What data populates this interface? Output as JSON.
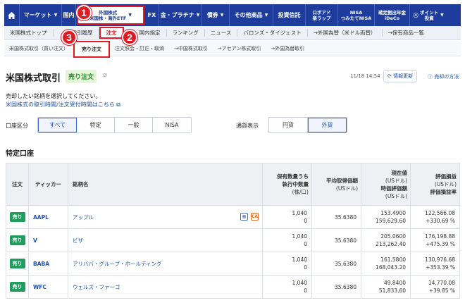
{
  "topnav": {
    "items": [
      {
        "label": "マーケット"
      },
      {
        "label": "国内"
      },
      {
        "label": "外国株式",
        "sub": "米国株・海外ETF"
      },
      {
        "label": "FX"
      },
      {
        "label": "金・プラチナ"
      },
      {
        "label": "債券"
      },
      {
        "label": "その他商品"
      },
      {
        "label": "投資信託"
      },
      {
        "label": "ロボアド",
        "sub": "楽ラップ"
      },
      {
        "label": "NISA",
        "sub": "つみたてNISA"
      },
      {
        "label": "確定拠出年金",
        "sub": "iDeCo"
      },
      {
        "label": "ポイント",
        "sub": "投資"
      }
    ]
  },
  "subnav1": {
    "items": [
      "米国株式トップ",
      "取引履歴",
      "注文",
      "国内指定",
      "ランキング",
      "ニュース",
      "バロンズ・ダイジェスト",
      "→外国為替（米ドル両替）",
      "→保有商品一覧"
    ]
  },
  "subnav2": {
    "items": [
      "米国株式取引（買い注文）",
      "売り注文",
      "注文照会・訂正・取消",
      "→中国株式取引",
      "→アセアン株式取引",
      "→外国為替取引"
    ]
  },
  "badges": [
    "1",
    "2",
    "3"
  ],
  "page": {
    "title": "米国株式取引",
    "tag": "売り注文",
    "timestamp": "11/18 14:54",
    "refresh_label": "情報更新",
    "howto_label": "売却の方法",
    "description": "売却したい銘柄を選択してください。",
    "link": "米国株式の取引時間/注文受付時間はこちら"
  },
  "filters": {
    "account_label": "口座区分",
    "account_options": [
      "すべて",
      "特定",
      "一般",
      "NISA"
    ],
    "account_selected": "すべて",
    "currency_label": "通貨表示",
    "currency_options": [
      "円貨",
      "外貨"
    ],
    "currency_selected": "外貨"
  },
  "section_title": "特定口座",
  "table": {
    "headers": {
      "order": "注文",
      "ticker": "ティッカー",
      "name": "銘柄名",
      "qty1": "保有数量うち",
      "qty2": "執行中数量",
      "qty3": "(株/口)",
      "avg1": "平均取得価額",
      "avg2": "(USドル)",
      "cur1": "現在値",
      "cur2": "(USドル)",
      "cur3": "時価評価額",
      "cur4": "(USドル)",
      "pl1": "評価損益",
      "pl2": "(USドル)",
      "pl3": "評価損益率"
    },
    "sell_label": "売り",
    "rows": [
      {
        "ticker": "AAPL",
        "name": "アップル",
        "qty": "1,040",
        "qty_exec": "0",
        "avg": "35.6380",
        "price": "153.4900",
        "value": "159,629.60",
        "pl": "122,566.08",
        "plr": "+330.69 %",
        "icons": true
      },
      {
        "ticker": "V",
        "name": "ビザ",
        "qty": "1,040",
        "qty_exec": "0",
        "avg": "35.6380",
        "price": "205.0600",
        "value": "213,262.40",
        "pl": "176,198.88",
        "plr": "+475.39 %",
        "icons": false
      },
      {
        "ticker": "BABA",
        "name": "アリババ・グループ・ホールディング",
        "qty": "1,040",
        "qty_exec": "0",
        "avg": "35.6380",
        "price": "161.5800",
        "value": "168,043.20",
        "pl": "130,976.68",
        "plr": "+353.39 %",
        "icons": false
      },
      {
        "ticker": "WFC",
        "name": "ウェルズ・ファーゴ",
        "qty": "1,040",
        "qty_exec": "0",
        "avg": "35.6380",
        "price": "49.8400",
        "value": "51,833.60",
        "pl": "14,770.08",
        "plr": "+39.85 %",
        "icons": false
      }
    ]
  },
  "colors": {
    "nav_bg": "#1d3c9c",
    "highlight_red": "#e21b23",
    "sell_green": "#1f9d5c",
    "link_blue": "#1d4faa"
  }
}
